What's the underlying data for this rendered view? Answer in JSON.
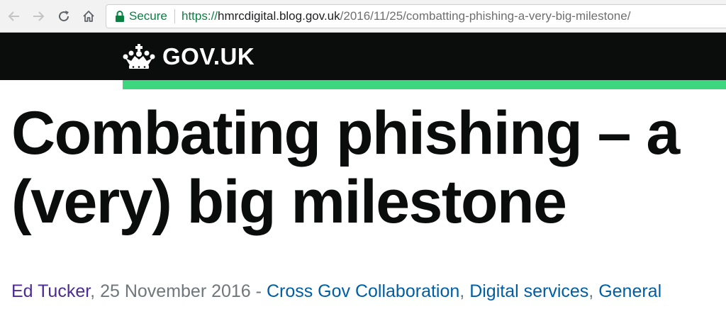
{
  "browser": {
    "secure_label": "Secure",
    "url_scheme": "https://",
    "url_host": "hmrcdigital.blog.gov.uk",
    "url_path": "/2016/11/25/combatting-phishing-a-very-big-milestone/"
  },
  "header": {
    "logotype": "GOV.UK"
  },
  "article": {
    "title": "Combating phishing – a (very) big milestone",
    "author": "Ed Tucker",
    "date_sep": ", ",
    "date": "25 November 2016",
    "dash": " - ",
    "categories": [
      "Cross Gov Collaboration",
      "Digital services",
      "General"
    ],
    "cat_sep": ", "
  },
  "colors": {
    "header_black": "#0b0c0c",
    "stripe_green": "#3ed77f",
    "secure_green": "#0b8043",
    "author_purple": "#4c2c92",
    "link_blue": "#005ea5"
  },
  "icons": {
    "back": "arrow-left-icon",
    "forward": "arrow-right-icon",
    "reload": "reload-icon",
    "home": "home-icon",
    "secure": "lock-icon",
    "logo": "crown-icon"
  }
}
